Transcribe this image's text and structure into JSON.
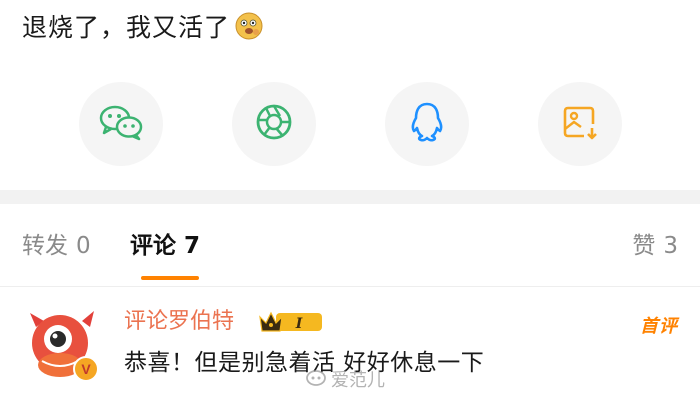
{
  "post": {
    "text": "退烧了，我又活了",
    "emoji": "cat-face-emoji"
  },
  "share": [
    {
      "name": "wechat",
      "icon": "wechat-icon",
      "color": "#3cb371"
    },
    {
      "name": "moments",
      "icon": "moments-aperture-icon",
      "color": "#3cb371"
    },
    {
      "name": "qq",
      "icon": "qq-penguin-icon",
      "color": "#1e90ff"
    },
    {
      "name": "save-image",
      "icon": "save-image-icon",
      "color": "#f5a623"
    }
  ],
  "tabs": {
    "repost": {
      "label": "转发",
      "count": "0"
    },
    "comment": {
      "label": "评论",
      "count": "7"
    },
    "like": {
      "label": "赞",
      "count": "3"
    }
  },
  "comment": {
    "author": "评论罗伯特",
    "badge": "I",
    "text": "恭喜！但是别急着活 好好休息一下",
    "tag": "首评"
  },
  "watermark": {
    "text": "爱范儿"
  },
  "colors": {
    "accent": "#ff8200",
    "name": "#eb7350"
  }
}
